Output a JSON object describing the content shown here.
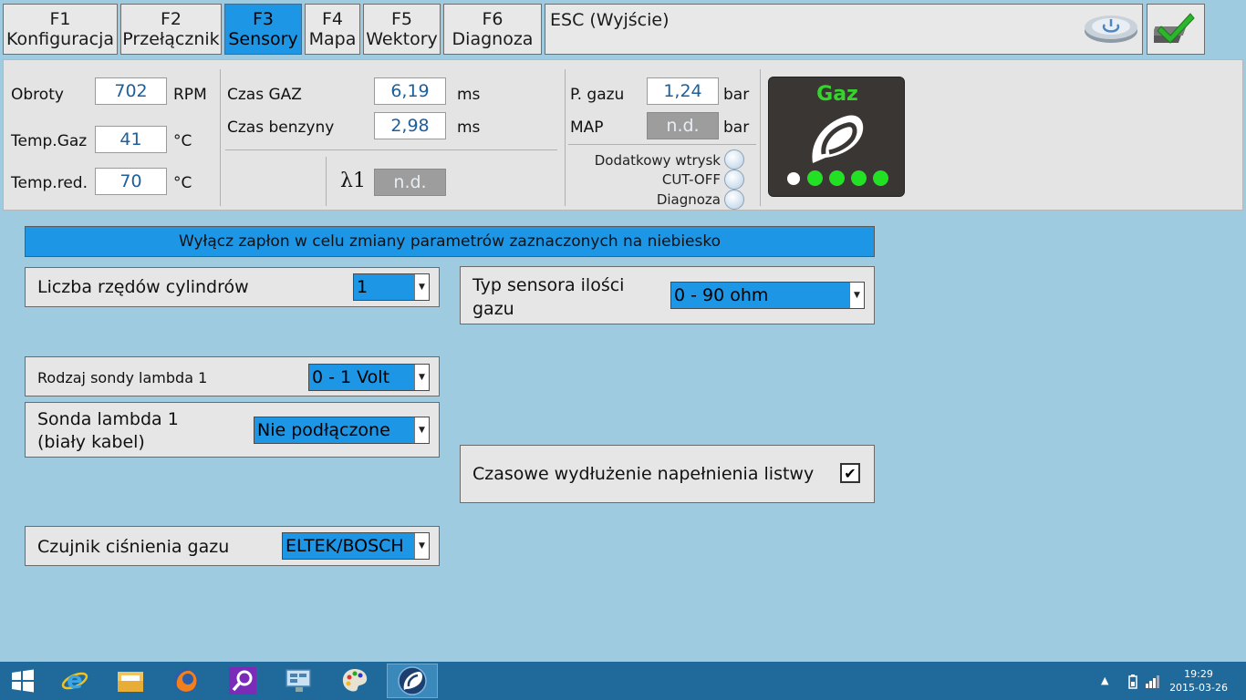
{
  "tabs": [
    {
      "key": "F1",
      "label": "Konfiguracja",
      "active": false
    },
    {
      "key": "F2",
      "label": "Przełącznik",
      "active": false
    },
    {
      "key": "F3",
      "label": "Sensory",
      "active": true
    },
    {
      "key": "F4",
      "label": "Mapa",
      "active": false
    },
    {
      "key": "F5",
      "label": "Wektory",
      "active": false
    },
    {
      "key": "F6",
      "label": "Diagnoza",
      "active": false
    }
  ],
  "esc_label": "ESC (Wyjście)",
  "status": {
    "rpm_label": "Obroty",
    "rpm_value": "702",
    "rpm_unit": "RPM",
    "tgaz_label": "Temp.Gaz",
    "tgaz_value": "41",
    "tgaz_unit": "°C",
    "tred_label": "Temp.red.",
    "tred_value": "70",
    "tred_unit": "°C",
    "czas_gaz_label": "Czas GAZ",
    "czas_gaz_value": "6,19",
    "czas_gaz_unit": "ms",
    "czas_benz_label": "Czas benzyny",
    "czas_benz_value": "2,98",
    "czas_benz_unit": "ms",
    "lambda_label": "λ1",
    "lambda_value": "n.d.",
    "pgazu_label": "P. gazu",
    "pgazu_value": "1,24",
    "pgazu_unit": "bar",
    "map_label": "MAP",
    "map_value": "n.d.",
    "map_unit": "bar",
    "indicators": [
      "Dodatkowy wtrysk",
      "CUT-OFF",
      "Diagnoza"
    ],
    "gaz_title": "Gaz"
  },
  "main": {
    "banner": "Wyłącz zapłon w celu zmiany parametrów zaznaczonych na niebiesko",
    "cyl_rows_label": "Liczba rzędów cylindrów",
    "cyl_rows_value": "1",
    "gas_sensor_label_1": "Typ sensora ilości",
    "gas_sensor_label_2": "gazu",
    "gas_sensor_value": "0 - 90 ohm",
    "lambda_type_label": "Rodzaj sondy lambda 1",
    "lambda_type_value": "0 - 1 Volt",
    "lambda_conn_label_1": "Sonda lambda 1",
    "lambda_conn_label_2": "(biały kabel)",
    "lambda_conn_value": "Nie podłączone",
    "rail_fill_label": "Czasowe wydłużenie napełnienia listwy",
    "rail_fill_checked": "✔",
    "pressure_sensor_label": "Czujnik ciśnienia gazu",
    "pressure_sensor_value": "ELTEK/BOSCH"
  },
  "taskbar": {
    "time": "19:29",
    "date": "2015-03-26"
  }
}
